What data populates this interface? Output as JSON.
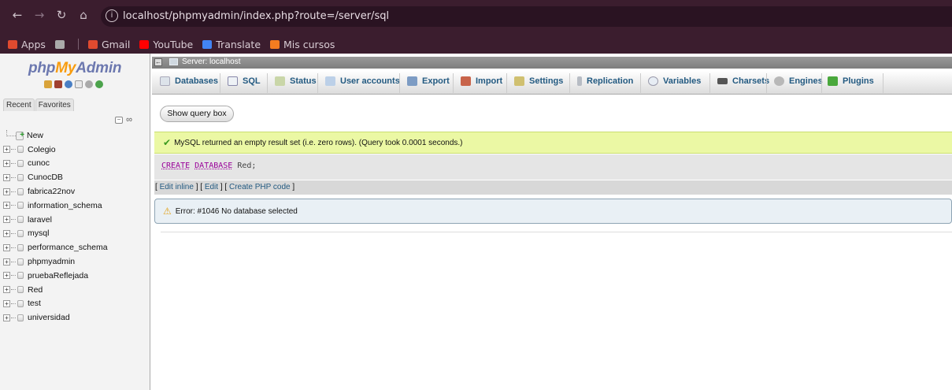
{
  "browser": {
    "url": "localhost/phpmyadmin/index.php?route=/server/sql",
    "bookmarks": [
      {
        "label": "Apps",
        "color": "#e04a2f"
      },
      {
        "label": "",
        "color": "#aaaaaa"
      },
      {
        "label": "Gmail",
        "color": "#e04a2f"
      },
      {
        "label": "YouTube",
        "color": "#ff0000"
      },
      {
        "label": "Translate",
        "color": "#4285f4"
      },
      {
        "label": "Mis cursos",
        "color": "#f47c20"
      }
    ]
  },
  "sidebar": {
    "logo_php": "php",
    "logo_my": "My",
    "logo_admin": "Admin",
    "tab_recent": "Recent",
    "tab_favorites": "Favorites",
    "new_label": "New",
    "databases": [
      "Colegio",
      "cunoc",
      "CunocDB",
      "fabrica22nov",
      "information_schema",
      "laravel",
      "mysql",
      "performance_schema",
      "phpmyadmin",
      "pruebaReflejada",
      "Red",
      "test",
      "universidad"
    ]
  },
  "server_bar": {
    "label": "Server: localhost"
  },
  "menu": {
    "databases": "Databases",
    "sql": "SQL",
    "status": "Status",
    "user_accounts": "User accounts",
    "export": "Export",
    "import": "Import",
    "settings": "Settings",
    "replication": "Replication",
    "variables": "Variables",
    "charsets": "Charsets",
    "engines": "Engines",
    "plugins": "Plugins"
  },
  "query": {
    "show_query_box": "Show query box",
    "success_message": "MySQL returned an empty result set (i.e. zero rows). (Query took 0.0001 seconds.)",
    "sql_kw1": "CREATE",
    "sql_kw2": "DATABASE",
    "sql_rest": " Red;",
    "edit_inline": "Edit inline",
    "edit": "Edit",
    "create_php": "Create PHP code",
    "error_message": "Error: #1046 No database selected"
  }
}
